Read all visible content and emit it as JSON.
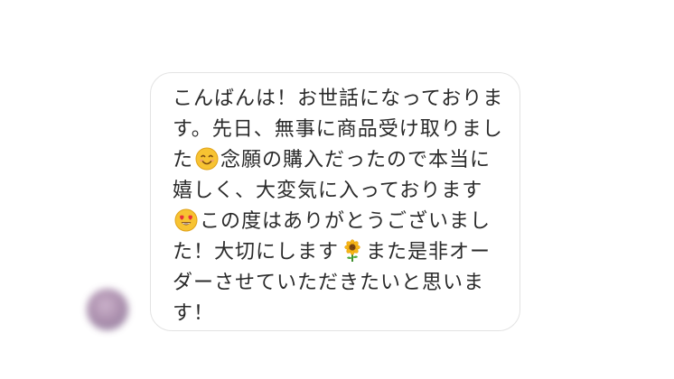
{
  "message": {
    "line1": "こんばんは！お世話になっておりま",
    "line2": "す。先日、無事に商品受け取りまし",
    "line3_a": "た",
    "line3_b": "念願の購入だったので本当に",
    "line4": "嬉しく、大変気に入っております",
    "line5_b": "この度はありがとうございまし",
    "line6_a": "た！大切にします",
    "line6_b": "また是非オー",
    "line7": "ダーさせていただきたいと思いま",
    "line8": "す！"
  },
  "emojis": {
    "smile": "smiling-face-icon",
    "heart_eyes": "heart-eyes-face-icon",
    "sunflower": "sunflower-icon"
  }
}
